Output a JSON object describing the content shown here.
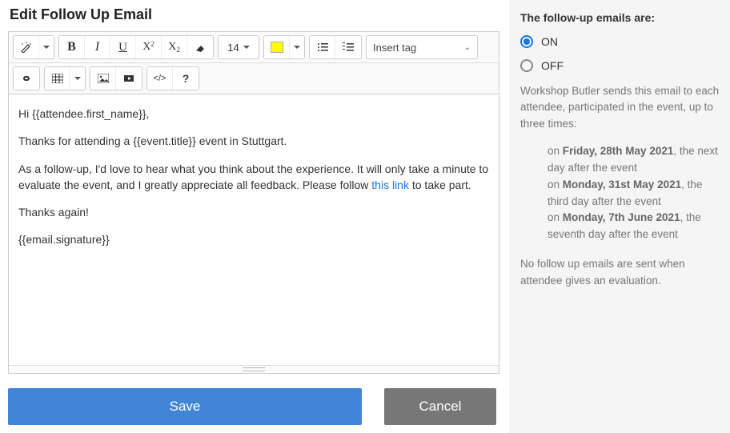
{
  "title": "Edit Follow Up Email",
  "toolbar": {
    "font_size": "14",
    "highlight_color": "#ffff00",
    "insert_tag_label": "Insert tag"
  },
  "body": {
    "p1": "Hi {{attendee.first_name}},",
    "p2": "Thanks for attending a {{event.title}} event in Stuttgart.",
    "p3a": "As a follow-up, I'd love to hear what you think about the experience. It will only take a minute to evaluate the event, and I greatly appreciate all feedback. Please follow ",
    "p3_link": "this link",
    "p3b": " to take part.",
    "p4": "Thanks again!",
    "p5": "{{email.signature}}"
  },
  "actions": {
    "save": "Save",
    "cancel": "Cancel"
  },
  "sidebar": {
    "heading": "The follow-up emails are:",
    "on_label": "ON",
    "off_label": "OFF",
    "selected": "on",
    "desc": "Workshop Butler sends this email to each attendee, participated in the event, up to three times:",
    "schedule": {
      "l1a": "on ",
      "l1b": "Friday, 28th May 2021",
      "l1c": ", the next day after the event",
      "l2a": "on ",
      "l2b": "Monday, 31st May 2021",
      "l2c": ", the third day after the event",
      "l3a": "on ",
      "l3b": "Monday, 7th June 2021",
      "l3c": ", the seventh day after the event"
    },
    "note": "No follow up emails are sent when attendee gives an evaluation."
  }
}
